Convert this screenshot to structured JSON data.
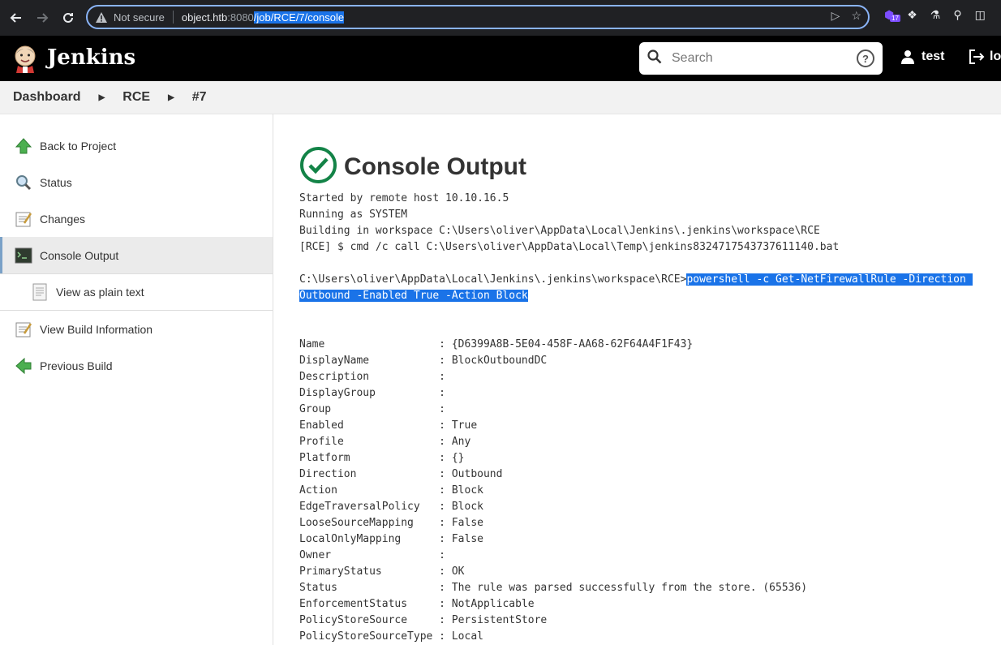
{
  "browser": {
    "not_secure": "Not secure",
    "host": "object.htb",
    "port": ":8080",
    "path": "/job/RCE/7/console",
    "ext_badge": "17"
  },
  "header": {
    "brand": "Jenkins",
    "search_placeholder": "Search",
    "help": "?",
    "user": "test",
    "logout": "lo"
  },
  "breadcrumbs": [
    "Dashboard",
    "RCE",
    "#7"
  ],
  "sidebar": {
    "items": [
      {
        "label": "Back to Project",
        "icon": "up-arrow-icon"
      },
      {
        "label": "Status",
        "icon": "magnifier-icon"
      },
      {
        "label": "Changes",
        "icon": "notepad-icon"
      },
      {
        "label": "Console Output",
        "icon": "terminal-icon"
      },
      {
        "label": "View as plain text",
        "icon": "document-icon"
      },
      {
        "label": "View Build Information",
        "icon": "notepad-icon"
      },
      {
        "label": "Previous Build",
        "icon": "left-arrow-icon"
      }
    ]
  },
  "main": {
    "title": "Console Output",
    "lines": [
      "Started by remote host 10.10.16.5",
      "Running as SYSTEM",
      "Building in workspace C:\\Users\\oliver\\AppData\\Local\\Jenkins\\.jenkins\\workspace\\RCE",
      "[RCE] $ cmd /c call C:\\Users\\oliver\\AppData\\Local\\Temp\\jenkins8324717543737611140.bat"
    ],
    "prompt": "C:\\Users\\oliver\\AppData\\Local\\Jenkins\\.jenkins\\workspace\\RCE>",
    "command_line1": "powershell -c Get-NetFirewallRule -Direction ",
    "command_line2": "Outbound -Enabled True -Action Block",
    "rule": [
      "Name                  : {D6399A8B-5E04-458F-AA68-62F64A4F1F43}",
      "DisplayName           : BlockOutboundDC",
      "Description           : ",
      "DisplayGroup          : ",
      "Group                 : ",
      "Enabled               : True",
      "Profile               : Any",
      "Platform              : {}",
      "Direction             : Outbound",
      "Action                : Block",
      "EdgeTraversalPolicy   : Block",
      "LooseSourceMapping    : False",
      "LocalOnlyMapping      : False",
      "Owner                 : ",
      "PrimaryStatus         : OK",
      "Status                : The rule was parsed successfully from the store. (65536)",
      "EnforcementStatus     : NotApplicable",
      "PolicyStoreSource     : PersistentStore",
      "PolicyStoreSourceType : Local"
    ]
  }
}
